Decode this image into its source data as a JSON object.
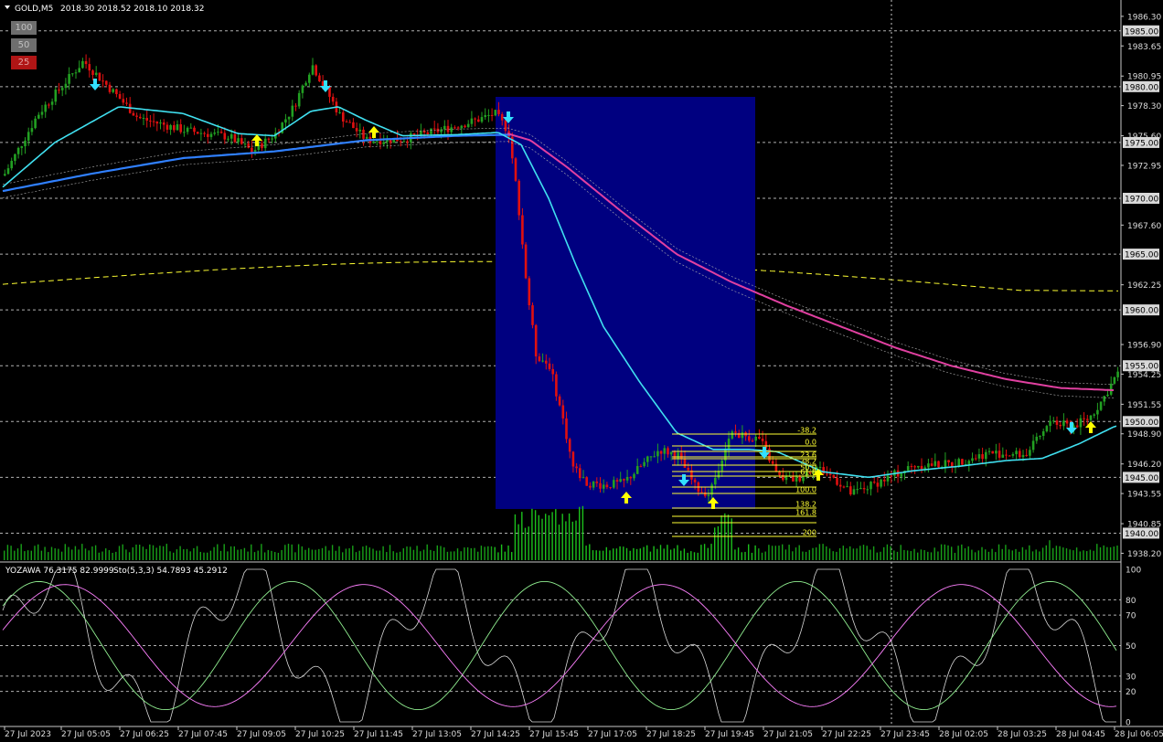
{
  "header": {
    "symbol": "GOLD,M5",
    "quote": "2018.30 2018.52 2018.10 2018.32",
    "indicator": "YOZAWA 76.3175 82.9999",
    "stoch": "Sto(5,3,3) 54.7893 45.2912"
  },
  "buttons": [
    {
      "label": "100",
      "bg": "#6e6e6e",
      "fg": "#c0c0c0"
    },
    {
      "label": "50",
      "bg": "#6e6e6e",
      "fg": "#c0c0c0"
    },
    {
      "label": "25",
      "bg": "#b01515",
      "fg": "#e0a0a0"
    }
  ],
  "chart_data": {
    "type": "candlestick",
    "price_axis": [
      "1986.30",
      "1985.00",
      "1983.65",
      "1980.95",
      "1980.00",
      "1978.30",
      "1975.60",
      "1975.00",
      "1972.95",
      "1970.00",
      "1967.60",
      "1965.00",
      "1962.25",
      "1960.00",
      "1956.90",
      "1955.00",
      "1954.25",
      "1951.55",
      "1950.00",
      "1948.90",
      "1946.20",
      "1945.00",
      "1943.55",
      "1940.85",
      "1940.00",
      "1938.20"
    ],
    "highlighted_levels": [
      "1985.00",
      "1980.00",
      "1975.00",
      "1970.00",
      "1965.00",
      "1960.00",
      "1955.00",
      "1950.00",
      "1945.00",
      "1940.00"
    ],
    "time_axis": [
      "27 Jul 2023",
      "27 Jul 05:05",
      "27 Jul 06:25",
      "27 Jul 07:45",
      "27 Jul 09:05",
      "27 Jul 10:25",
      "27 Jul 11:45",
      "27 Jul 13:05",
      "27 Jul 14:25",
      "27 Jul 15:45",
      "27 Jul 17:05",
      "27 Jul 18:25",
      "27 Jul 19:45",
      "27 Jul 21:05",
      "27 Jul 22:25",
      "27 Jul 23:45",
      "28 Jul 02:05",
      "28 Jul 03:25",
      "28 Jul 04:45",
      "28 Jul 06:05"
    ],
    "fib_levels": [
      "-38.2",
      "0.0",
      "23.6",
      "38.2",
      "50.0",
      "61.8",
      "100.0",
      "138.2",
      "161.8",
      "200"
    ],
    "osc_axis": [
      "100",
      "80",
      "70",
      "50",
      "30",
      "20",
      "0"
    ],
    "colors": {
      "bull": "#22a022",
      "bear": "#e01010",
      "ma_fast": "#40e0f0",
      "ma_mid": "#3080ff",
      "ma_slow": "#e040a0",
      "box": "#000080",
      "fib": "#ffff33",
      "stoch_main": "#90ee90",
      "stoch_signal": "#ff80ff"
    }
  }
}
